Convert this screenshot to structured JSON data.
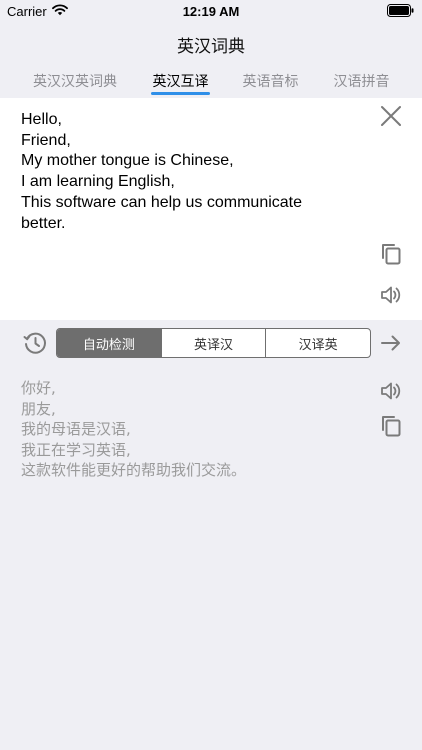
{
  "status_bar": {
    "carrier": "Carrier",
    "time": "12:19 AM"
  },
  "nav": {
    "title": "英汉词典"
  },
  "tabs": [
    {
      "label": "英汉汉英词典",
      "active": false
    },
    {
      "label": "英汉互译",
      "active": true
    },
    {
      "label": "英语音标",
      "active": false
    },
    {
      "label": "汉语拼音",
      "active": false
    }
  ],
  "input": {
    "lines": [
      "Hello,",
      "Friend,",
      "My mother tongue is Chinese,",
      "I am learning English,",
      "This software can help us communicate",
      "better."
    ]
  },
  "icons": {
    "clear": "close-icon",
    "copy": "copy-icon",
    "speak": "speaker-icon",
    "history": "history-icon",
    "go": "arrow-right-icon"
  },
  "modes": {
    "items": [
      "自动检测",
      "英译汉",
      "汉译英"
    ],
    "selected": "自动检测"
  },
  "output": {
    "lines": [
      "你好,",
      "朋友,",
      "我的母语是汉语,",
      "我正在学习英语,",
      "这款软件能更好的帮助我们交流。"
    ]
  },
  "colors": {
    "background": "#efeff4",
    "accent": "#2f8fe8",
    "icon_gray": "#7a7a7a",
    "output_text": "#9a9a9a",
    "segment_selected": "#6e6e6e"
  }
}
